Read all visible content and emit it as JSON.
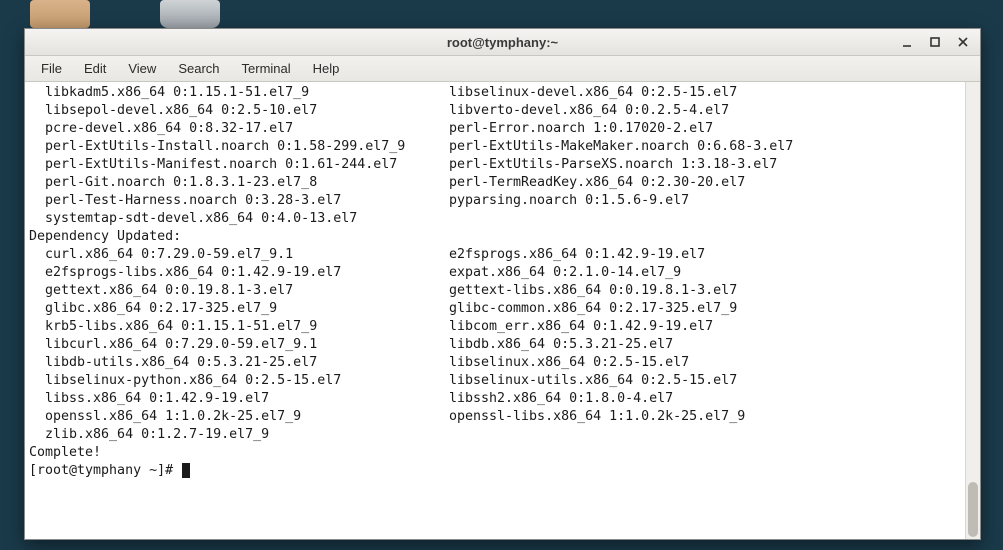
{
  "window": {
    "title": "root@tymphany:~"
  },
  "menus": [
    "File",
    "Edit",
    "View",
    "Search",
    "Terminal",
    "Help"
  ],
  "top_rows": [
    [
      "  libkadm5.x86_64 0:1.15.1-51.el7_9",
      "libselinux-devel.x86_64 0:2.5-15.el7"
    ],
    [
      "  libsepol-devel.x86_64 0:2.5-10.el7",
      "libverto-devel.x86_64 0:0.2.5-4.el7"
    ],
    [
      "  pcre-devel.x86_64 0:8.32-17.el7",
      "perl-Error.noarch 1:0.17020-2.el7"
    ],
    [
      "  perl-ExtUtils-Install.noarch 0:1.58-299.el7_9",
      "perl-ExtUtils-MakeMaker.noarch 0:6.68-3.el7"
    ],
    [
      "  perl-ExtUtils-Manifest.noarch 0:1.61-244.el7",
      "perl-ExtUtils-ParseXS.noarch 1:3.18-3.el7"
    ],
    [
      "  perl-Git.noarch 0:1.8.3.1-23.el7_8",
      "perl-TermReadKey.x86_64 0:2.30-20.el7"
    ],
    [
      "  perl-Test-Harness.noarch 0:3.28-3.el7",
      "pyparsing.noarch 0:1.5.6-9.el7"
    ],
    [
      "  systemtap-sdt-devel.x86_64 0:4.0-13.el7",
      ""
    ]
  ],
  "dep_header": "Dependency Updated:",
  "dep_rows": [
    [
      "  curl.x86_64 0:7.29.0-59.el7_9.1",
      "e2fsprogs.x86_64 0:1.42.9-19.el7"
    ],
    [
      "  e2fsprogs-libs.x86_64 0:1.42.9-19.el7",
      "expat.x86_64 0:2.1.0-14.el7_9"
    ],
    [
      "  gettext.x86_64 0:0.19.8.1-3.el7",
      "gettext-libs.x86_64 0:0.19.8.1-3.el7"
    ],
    [
      "  glibc.x86_64 0:2.17-325.el7_9",
      "glibc-common.x86_64 0:2.17-325.el7_9"
    ],
    [
      "  krb5-libs.x86_64 0:1.15.1-51.el7_9",
      "libcom_err.x86_64 0:1.42.9-19.el7"
    ],
    [
      "  libcurl.x86_64 0:7.29.0-59.el7_9.1",
      "libdb.x86_64 0:5.3.21-25.el7"
    ],
    [
      "  libdb-utils.x86_64 0:5.3.21-25.el7",
      "libselinux.x86_64 0:2.5-15.el7"
    ],
    [
      "  libselinux-python.x86_64 0:2.5-15.el7",
      "libselinux-utils.x86_64 0:2.5-15.el7"
    ],
    [
      "  libss.x86_64 0:1.42.9-19.el7",
      "libssh2.x86_64 0:1.8.0-4.el7"
    ],
    [
      "  openssl.x86_64 1:1.0.2k-25.el7_9",
      "openssl-libs.x86_64 1:1.0.2k-25.el7_9"
    ],
    [
      "  zlib.x86_64 0:1.2.7-19.el7_9",
      ""
    ]
  ],
  "complete": "Complete!",
  "prompt": "[root@tymphany ~]# "
}
